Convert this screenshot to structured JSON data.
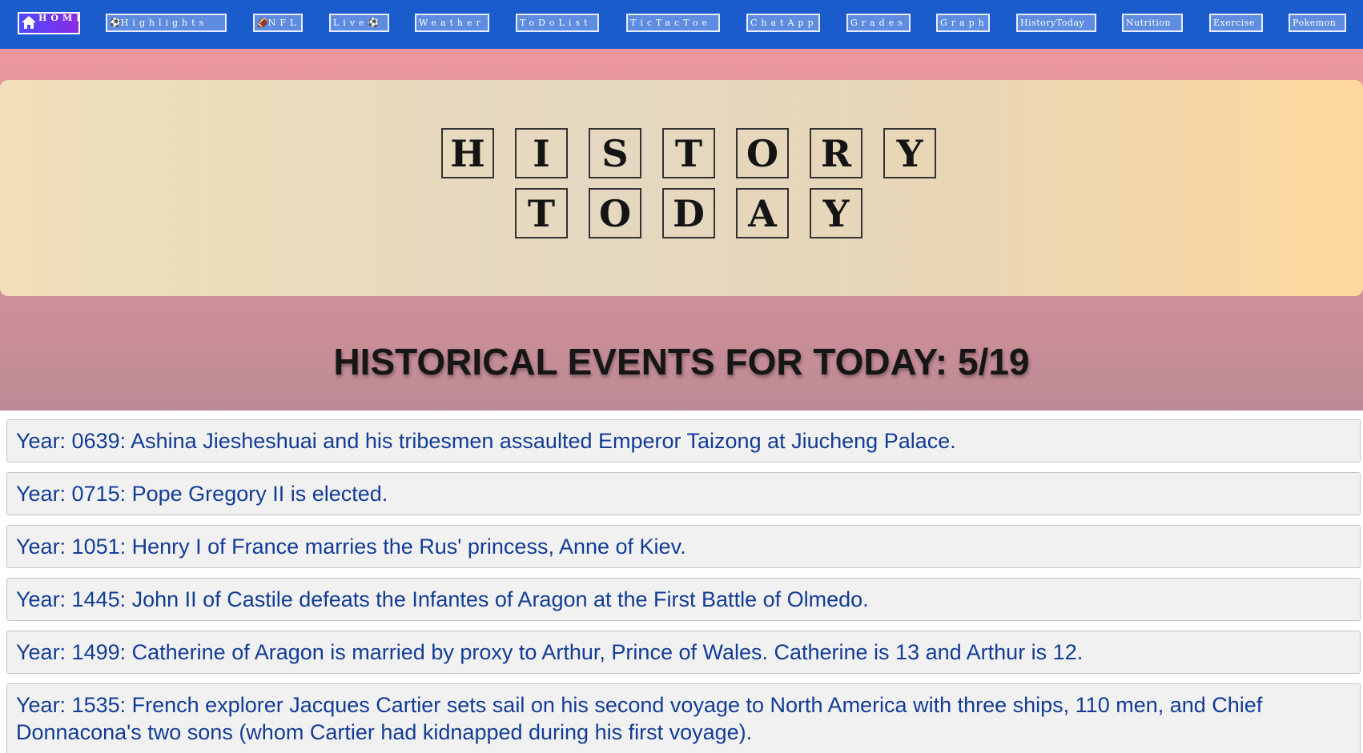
{
  "nav": {
    "home": "HOME",
    "items": [
      {
        "label": "Highlights",
        "icon": "soccer-ball-icon",
        "icon_pos": "before"
      },
      {
        "label": "NFL",
        "icon": "football-icon",
        "icon_pos": "before"
      },
      {
        "label": "Live",
        "icon": "soccer-ball-icon",
        "icon_pos": "after"
      },
      {
        "label": "Weather"
      },
      {
        "label": "ToDoList"
      },
      {
        "label": "TicTacToe"
      },
      {
        "label": "ChatApp"
      },
      {
        "label": "Grades"
      },
      {
        "label": "Graph"
      },
      {
        "label": "HistoryToday"
      },
      {
        "label": "Nutrition"
      },
      {
        "label": "Exercise"
      },
      {
        "label": "Pokemon"
      }
    ]
  },
  "hero": {
    "row1": [
      "H",
      "I",
      "S",
      "T",
      "O",
      "R",
      "Y"
    ],
    "row2": [
      "T",
      "O",
      "D",
      "A",
      "Y"
    ]
  },
  "heading": "HISTORICAL EVENTS FOR TODAY: 5/19",
  "events": [
    "Year: 0639: Ashina Jiesheshuai and his tribesmen assaulted Emperor Taizong at Jiucheng Palace.",
    "Year: 0715: Pope Gregory II is elected.",
    "Year: 1051: Henry I of France marries the Rus' princess, Anne of Kiev.",
    "Year: 1445: John II of Castile defeats the Infantes of Aragon at the First Battle of Olmedo.",
    "Year: 1499: Catherine of Aragon is married by proxy to Arthur, Prince of Wales. Catherine is 13 and Arthur is 12.",
    "Year: 1535: French explorer Jacques Cartier sets sail on his second voyage to North America with three ships, 110 men, and Chief Donnacona's two sons (whom Cartier had kidnapped during his first voyage)."
  ],
  "colors": {
    "nav_bg": "#1b5ccc",
    "nav_item_bg": "#5d8ce0",
    "event_text": "#123c96"
  }
}
